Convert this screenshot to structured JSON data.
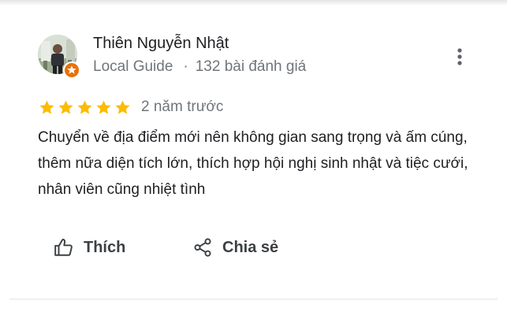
{
  "review": {
    "reviewer": {
      "name": "Thiên Nguyễn Nhật",
      "badge": "Local Guide",
      "separator": "·",
      "review_count": "132 bài đánh giá",
      "avatar_icon": "person-photo-avatar",
      "badge_icon": "local-guide-badge-icon"
    },
    "rating": {
      "stars": 5,
      "max_stars": 5,
      "star_color": "#fbbc04"
    },
    "date": "2 năm trước",
    "text": "Chuyển về địa điểm mới nên không gian sang trọng và ấm cúng, thêm nữa diện tích lớn, thích hợp hội nghị sinh nhật và tiệc cưới, nhân viên cũng nhiệt tình",
    "more_icon": "more-vert-icon"
  },
  "actions": {
    "like_label": "Thích",
    "like_icon": "thumb-up-icon",
    "share_label": "Chia sẻ",
    "share_icon": "share-icon"
  },
  "colors": {
    "name_text": "#202124",
    "secondary_text": "#70757a",
    "action_text": "#3c4043",
    "local_guide_badge": "#e8710a"
  }
}
